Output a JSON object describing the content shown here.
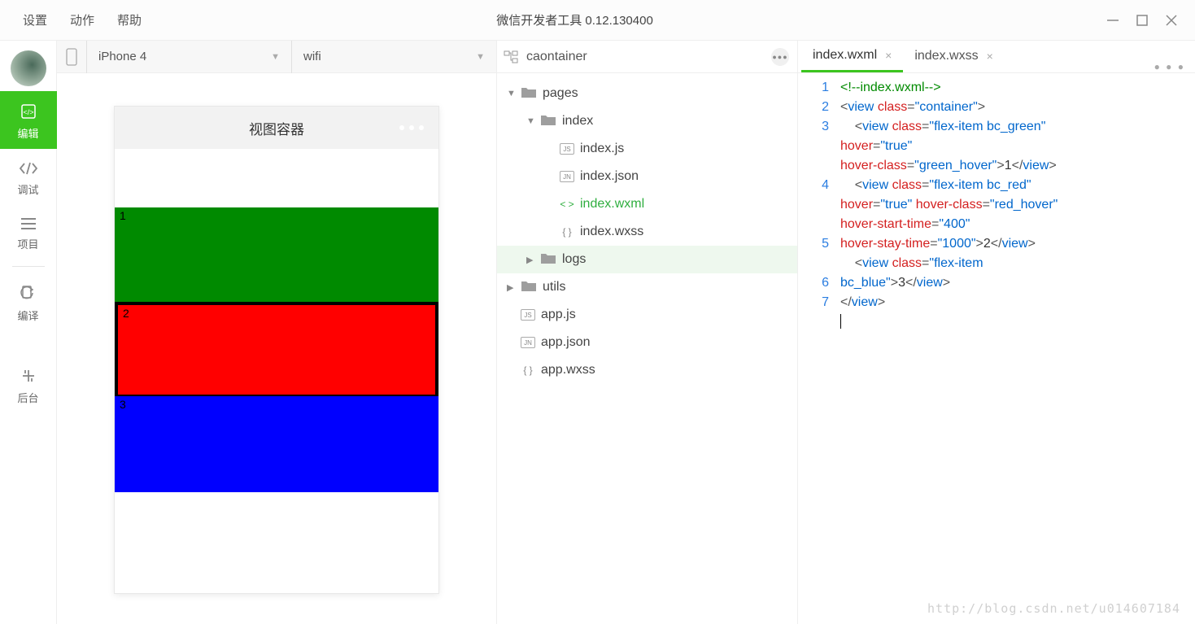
{
  "menu": {
    "settings": "设置",
    "actions": "动作",
    "help": "帮助"
  },
  "app_title": "微信开发者工具 0.12.130400",
  "sidebar": {
    "edit": "编辑",
    "debug": "调试",
    "project": "项目",
    "compile": "编译",
    "backend": "后台"
  },
  "toolbar": {
    "device": "iPhone 4",
    "network": "wifi"
  },
  "preview": {
    "title": "视图容器",
    "items": [
      {
        "label": "1",
        "cls": "bc_green"
      },
      {
        "label": "2",
        "cls": "bc_red"
      },
      {
        "label": "3",
        "cls": "bc_blue"
      }
    ]
  },
  "tree": {
    "crumb": "caontainer",
    "nodes": [
      {
        "label": "pages",
        "type": "folder",
        "depth": 0,
        "open": true
      },
      {
        "label": "index",
        "type": "folder",
        "depth": 1,
        "open": true
      },
      {
        "label": "index.js",
        "type": "file",
        "ext": "JS",
        "depth": 2
      },
      {
        "label": "index.json",
        "type": "file",
        "ext": "JN",
        "depth": 2
      },
      {
        "label": "index.wxml",
        "type": "file",
        "ext": "< >",
        "depth": 2,
        "active": true
      },
      {
        "label": "index.wxss",
        "type": "file",
        "ext": "{ }",
        "depth": 2
      },
      {
        "label": "logs",
        "type": "folder",
        "depth": 1,
        "closed": true,
        "selected": true
      },
      {
        "label": "utils",
        "type": "folder",
        "depth": 0,
        "closed": true
      },
      {
        "label": "app.js",
        "type": "file",
        "ext": "JS",
        "depth": 0
      },
      {
        "label": "app.json",
        "type": "file",
        "ext": "JN",
        "depth": 0
      },
      {
        "label": "app.wxss",
        "type": "file",
        "ext": "{ }",
        "depth": 0
      }
    ]
  },
  "tabs": [
    {
      "label": "index.wxml",
      "active": true
    },
    {
      "label": "index.wxss",
      "active": false
    }
  ],
  "code": {
    "line_numbers": [
      "1",
      "2",
      "3",
      "",
      "",
      "4",
      "",
      "",
      "5",
      "",
      "6",
      "7"
    ],
    "raw": "<!--index.wxml-->\n<view class=\"container\">\n    <view class=\"flex-item bc_green\" hover=\"true\" hover-class=\"green_hover\">1</view>\n    <view class=\"flex-item bc_red\" hover=\"true\" hover-class=\"red_hover\" hover-start-time=\"400\" hover-stay-time=\"1000\">2</view>\n    <view class=\"flex-item bc_blue\">3</view>\n</view>\n"
  },
  "watermark": "http://blog.csdn.net/u014607184"
}
